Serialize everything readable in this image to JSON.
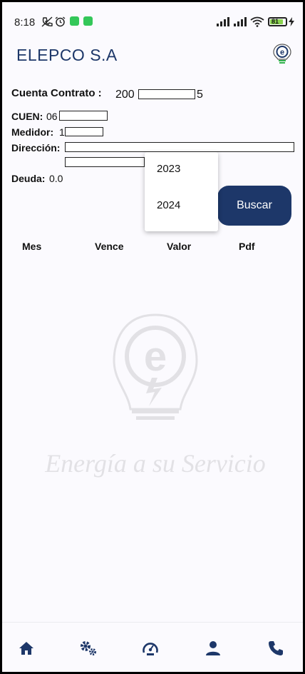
{
  "status_bar": {
    "time": "8:18",
    "battery_level": "81"
  },
  "app": {
    "title": "ELEPCO S.A",
    "brand_color": "#1d3769"
  },
  "account": {
    "contract_label": "Cuenta Contrato :",
    "contract_prefix": "200",
    "contract_suffix": "5",
    "cuen_label": "CUEN:",
    "cuen_value": "06",
    "meter_label": "Medidor:",
    "meter_value": "1",
    "address_label": "Dirección:",
    "debt_label": "Deuda:",
    "debt_value": "0.0"
  },
  "year_dropdown": {
    "options": [
      "2023",
      "2024"
    ]
  },
  "search_button": {
    "label": "Buscar"
  },
  "table": {
    "headers": [
      "Mes",
      "Vence",
      "Valor",
      "Pdf"
    ]
  },
  "watermark": {
    "slogan": "Energía a su Servicio"
  },
  "bottom_nav": {
    "items": [
      "home-icon",
      "settings-gears-icon",
      "meter-gauge-icon",
      "profile-icon",
      "phone-icon"
    ]
  }
}
